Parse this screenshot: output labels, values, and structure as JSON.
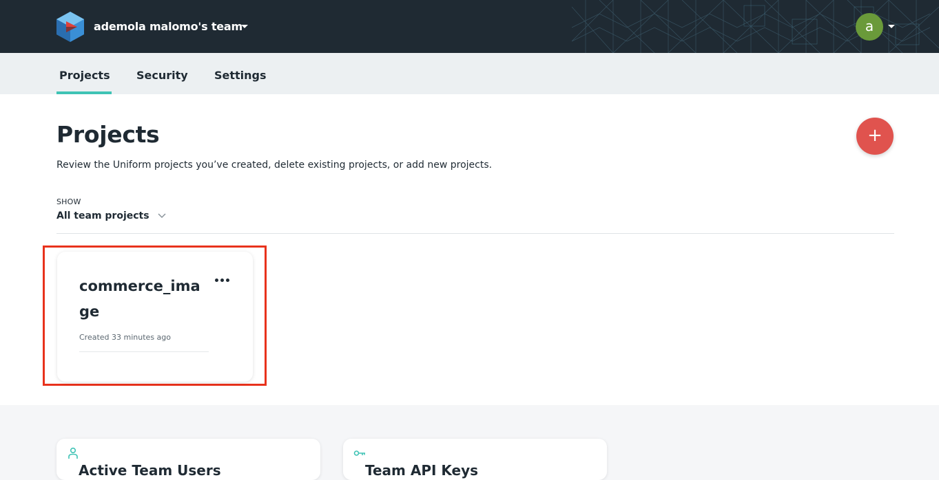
{
  "header": {
    "team_name": "ademola malomo's team",
    "avatar_letter": "a",
    "colors": {
      "bar": "#1f2a33",
      "avatar": "#6a9a3a"
    }
  },
  "tabs": [
    {
      "label": "Projects",
      "active": true
    },
    {
      "label": "Security",
      "active": false
    },
    {
      "label": "Settings",
      "active": false
    }
  ],
  "main": {
    "title": "Projects",
    "description": "Review the Uniform projects you’ve created, delete existing projects, or add new projects.",
    "add_button_symbol": "+",
    "filter": {
      "label": "SHOW",
      "value": "All team projects"
    },
    "projects": [
      {
        "name": "commerce_image",
        "created": "Created 33 minutes ago",
        "menu_icon": "more-icon"
      }
    ],
    "accent_color": "#3fc3b5",
    "add_color": "#e0534e",
    "highlight_color": "#e8321c"
  },
  "lower": {
    "cards": [
      {
        "icon": "user-icon",
        "title": "Active Team Users"
      },
      {
        "icon": "key-icon",
        "title": "Team API Keys"
      }
    ]
  }
}
